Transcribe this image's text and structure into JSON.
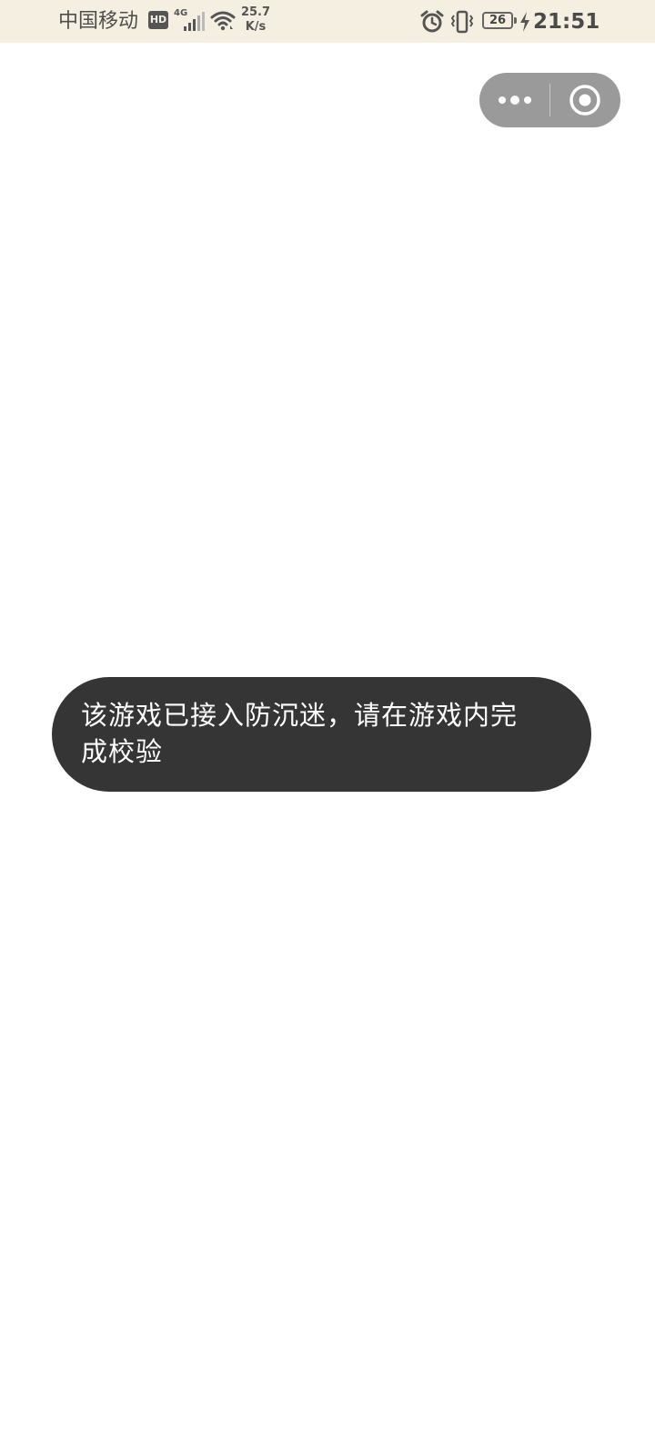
{
  "status_bar": {
    "carrier": "中国移动",
    "hd_badge": "HD",
    "network_type": "4G",
    "net_speed_value": "25.7",
    "net_speed_unit": "K/s",
    "battery_level": "26",
    "time": "21:51",
    "icons": [
      "signal-icon",
      "wifi-icon",
      "alarm-icon",
      "vibrate-icon",
      "battery-icon",
      "charging-icon"
    ]
  },
  "capsule": {
    "icons": [
      "more-icon",
      "close-target-icon"
    ]
  },
  "toast": {
    "message": "该游戏已接入防沉迷，请在游戏内完成校验"
  },
  "colors": {
    "status_bar_bg": "#f4efe0",
    "capsule_bg": "#9a9a9a",
    "toast_bg": "#353535",
    "page_bg": "#ffffff"
  }
}
